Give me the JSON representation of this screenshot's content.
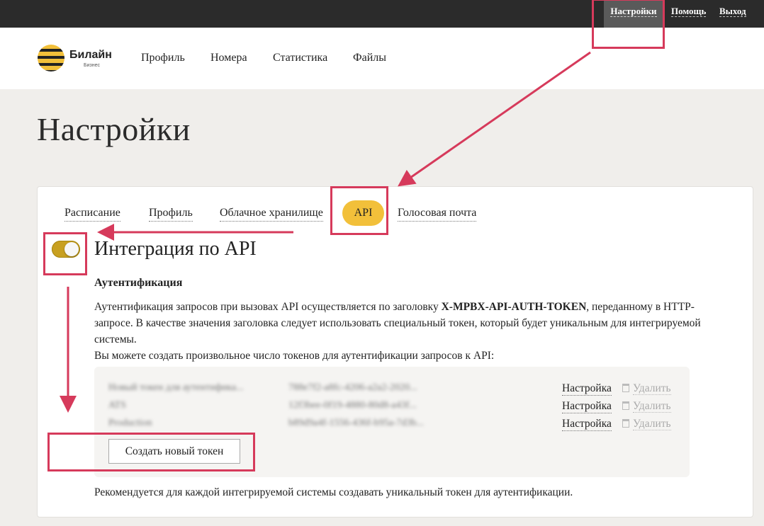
{
  "topbar": {
    "settings": "Настройки",
    "help": "Помощь",
    "exit": "Выход"
  },
  "logo": {
    "name": "Билайн",
    "sub": "Бизнес"
  },
  "nav": [
    {
      "label": "Профиль"
    },
    {
      "label": "Номера"
    },
    {
      "label": "Статистика"
    },
    {
      "label": "Файлы"
    }
  ],
  "page_title": "Настройки",
  "tabs": [
    {
      "label": "Расписание"
    },
    {
      "label": "Профиль"
    },
    {
      "label": "Облачное хранилище"
    },
    {
      "label": "API"
    },
    {
      "label": "Голосовая почта"
    }
  ],
  "integration": {
    "title": "Интеграция по API",
    "toggle_on": true,
    "auth_title": "Аутентификация",
    "desc_1": "Аутентификация запросов при вызовах API осуществляется по заголовку ",
    "header_name": "X-MPBX-API-AUTH-TOKEN",
    "desc_2": ", переданному в HTTP-запросе. В качестве значения заголовка следует использовать специальный токен, который будет уникальным для интегрируемой системы.",
    "desc_3": "Вы можете создать произвольное число токенов для аутентификации запросов к API:",
    "tokens": [
      {
        "name": "Новый токен для аутентифика...",
        "token": "788e7f2-a8fc-4206-a2a2-2020...",
        "settings": "Настройка",
        "delete": "Удалить"
      },
      {
        "name": "ATS",
        "token": "12f3bee-0f19-4880-80d8-a43f...",
        "settings": "Настройка",
        "delete": "Удалить"
      },
      {
        "name": "Production",
        "token": "b89d9a4f-1556-436f-b95a-7d3b...",
        "settings": "Настройка",
        "delete": "Удалить"
      }
    ],
    "create_button": "Создать новый токен",
    "footnote": "Рекомендуется для каждой интегрируемой системы создавать уникальный токен для аутентификации."
  },
  "colors": {
    "accent": "#f2c03a",
    "annotation": "#d63a5b",
    "topbar": "#2b2b2b"
  }
}
